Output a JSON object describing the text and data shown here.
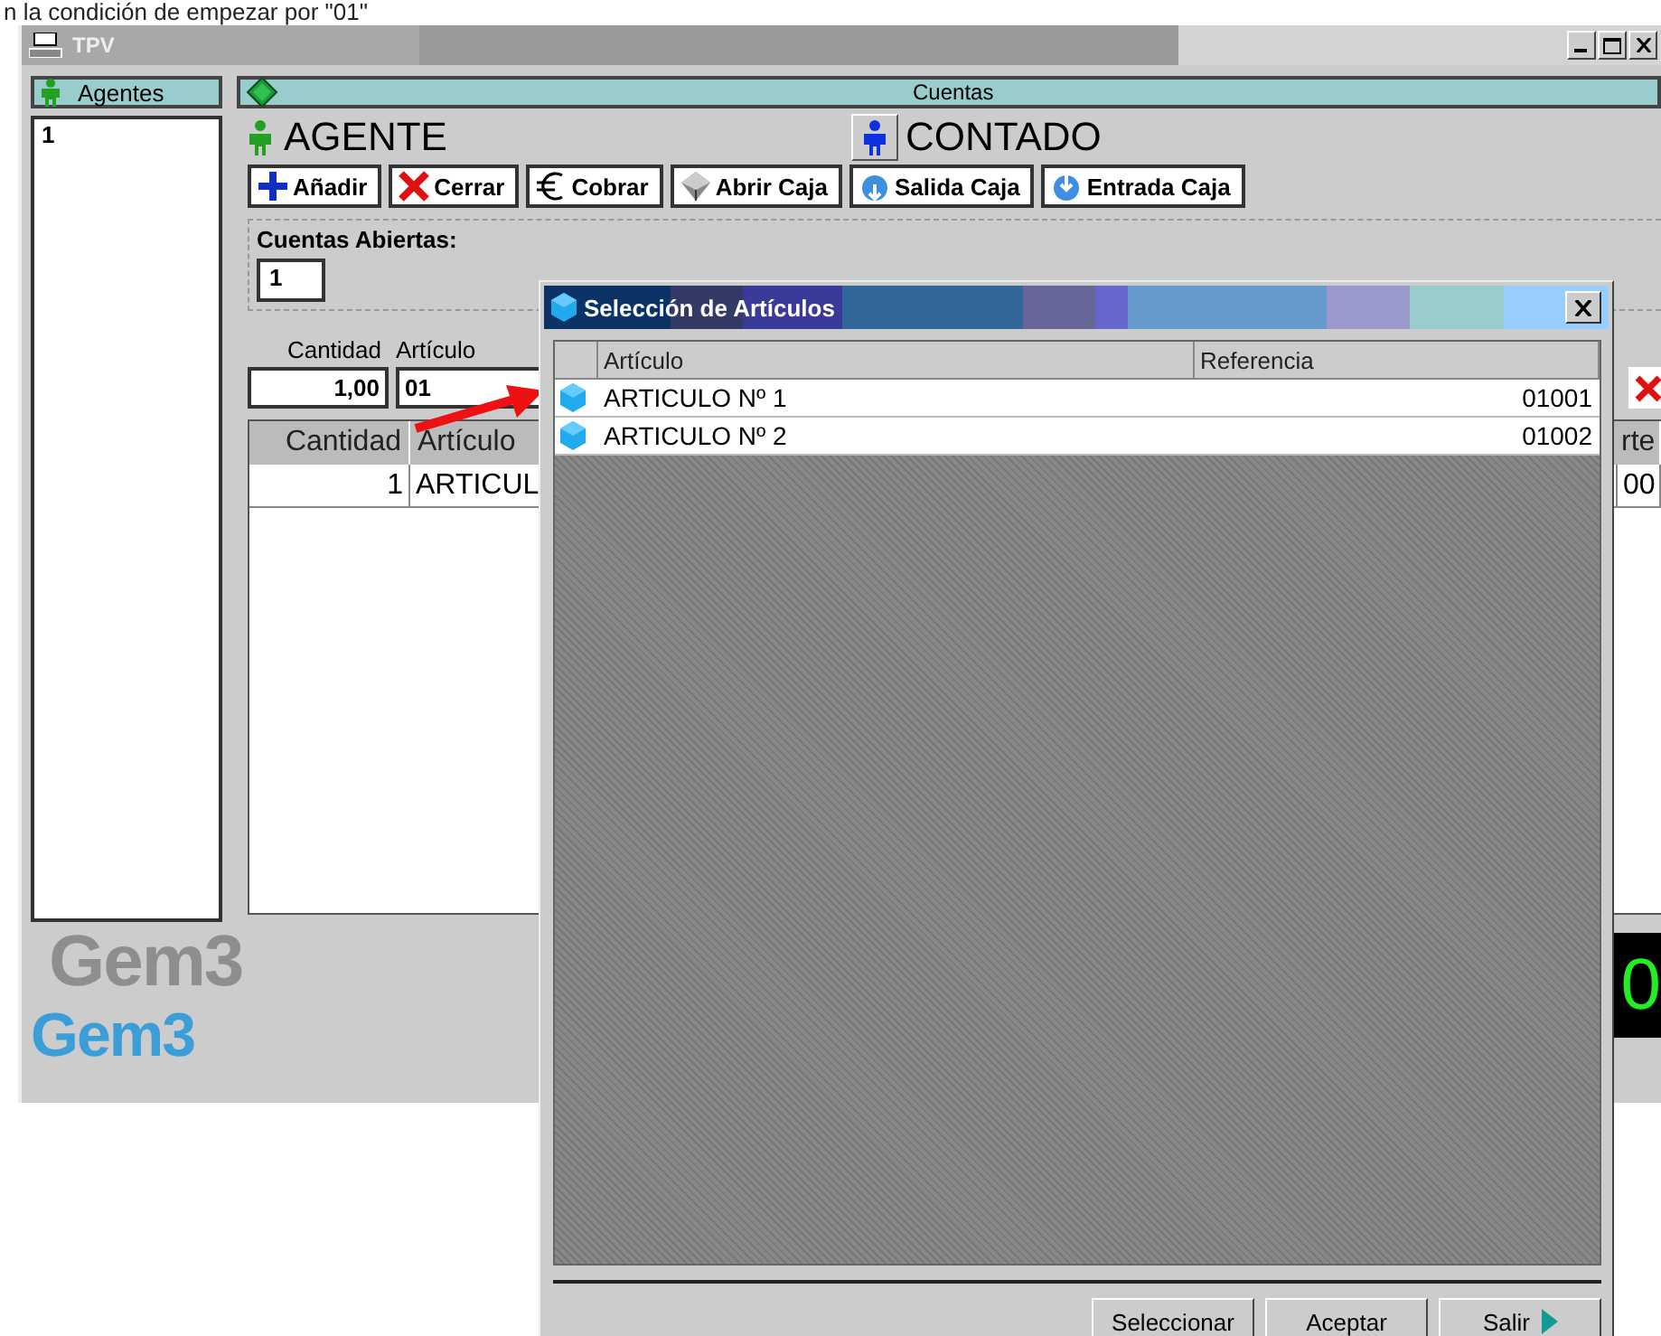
{
  "caption": "n la condición de empezar por \"01\"",
  "window": {
    "title": "TPV"
  },
  "agents": {
    "header": "Agentes",
    "items": [
      {
        "label": "1"
      }
    ]
  },
  "accounts": {
    "header": "Cuentas",
    "agent": "AGENTE",
    "client": "CONTADO",
    "buttons": [
      {
        "label": "Añadir",
        "kind": "plus"
      },
      {
        "label": "Cerrar",
        "kind": "cross"
      },
      {
        "label": "Cobrar",
        "kind": "euro"
      },
      {
        "label": "Abrir Caja",
        "kind": "box"
      },
      {
        "label": "Salida Caja",
        "kind": "out"
      },
      {
        "label": "Entrada Caja",
        "kind": "in"
      }
    ],
    "open_label": "Cuentas Abiertas:",
    "open_value": "1",
    "quantity_label": "Cantidad",
    "article_label": "Artículo",
    "quantity": "1,00",
    "article": "01",
    "lines": {
      "columns": [
        "Cantidad",
        "Artículo"
      ],
      "column_3": "rte",
      "rows": [
        {
          "cantidad": "1",
          "articulo": "ARTICUL",
          "column_3": "00"
        }
      ]
    },
    "display": "0"
  },
  "logo": {
    "shadow": "Gem3",
    "text": "Gem3"
  },
  "dialog": {
    "title": "Selección de Artículos",
    "columns": [
      "Artículo",
      "Referencia"
    ],
    "rows": [
      {
        "name": "ARTICULO Nº 1",
        "ref": "01001"
      },
      {
        "name": "ARTICULO Nº 2",
        "ref": "01002"
      }
    ],
    "buttons": [
      {
        "label": "Seleccionar",
        "kind": "plain"
      },
      {
        "label": "Aceptar",
        "kind": "plain"
      },
      {
        "label": "Salir",
        "kind": "exit"
      }
    ]
  }
}
